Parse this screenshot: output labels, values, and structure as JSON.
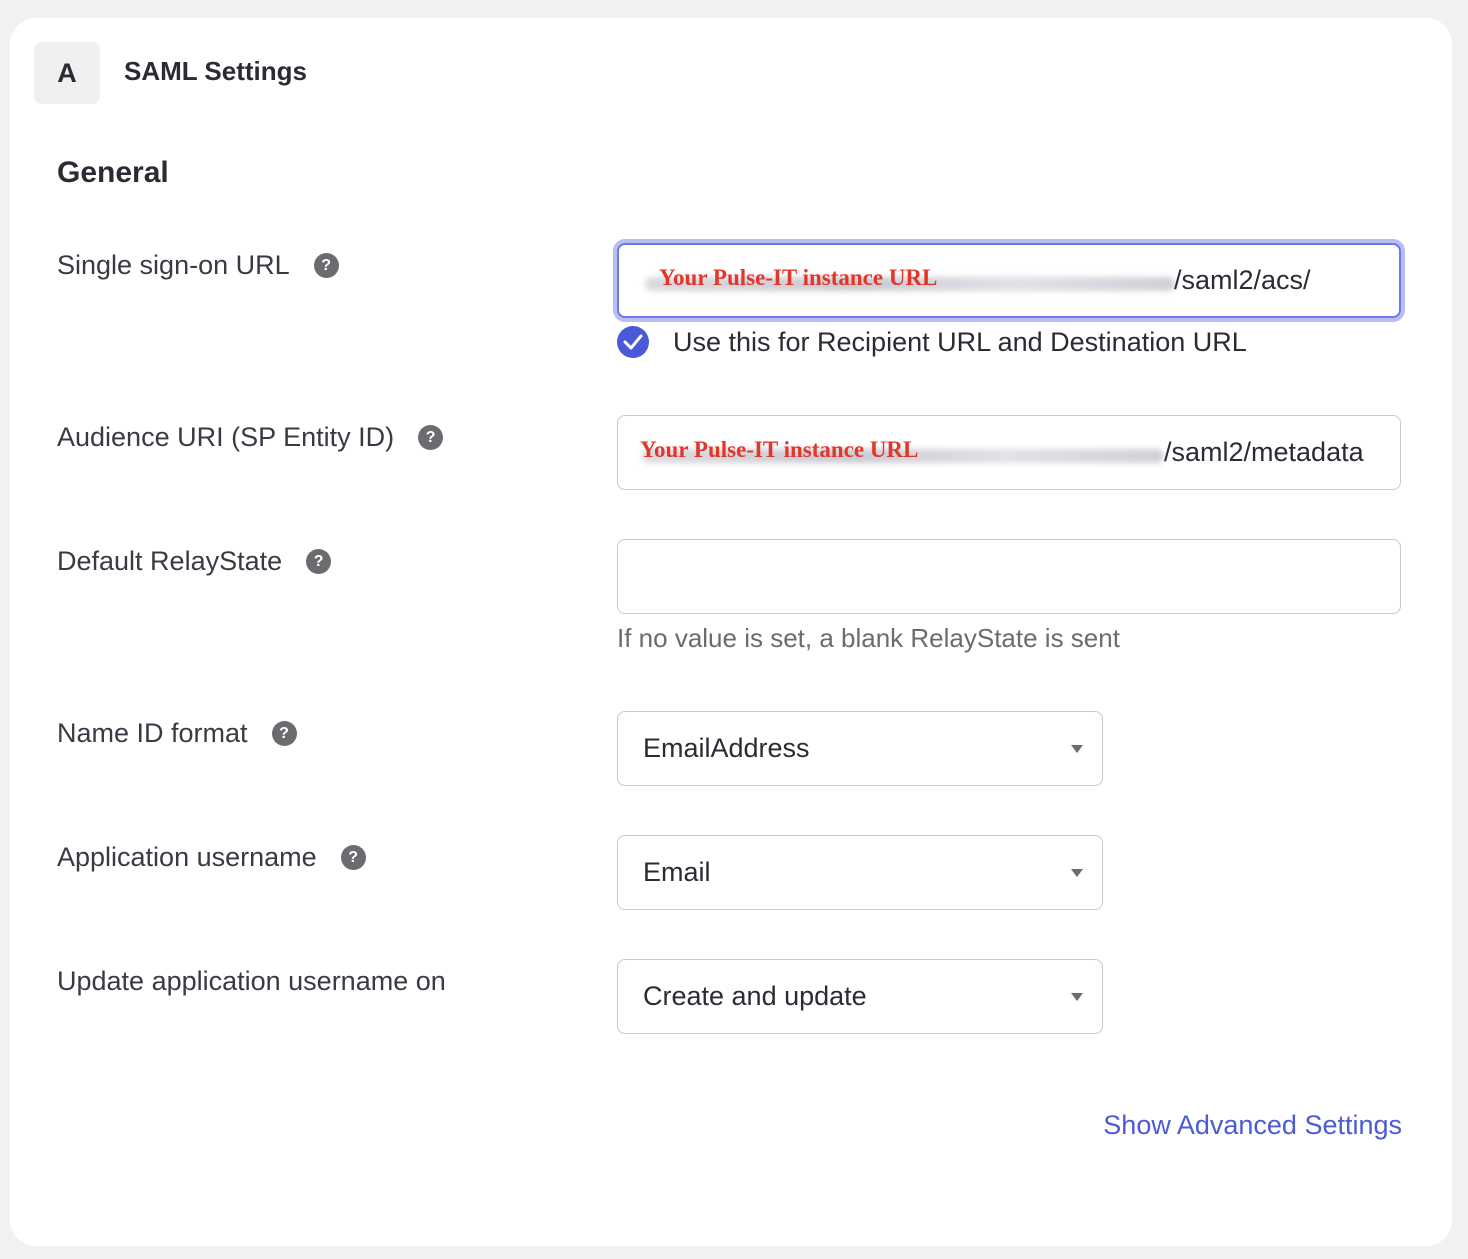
{
  "header": {
    "step": "A",
    "title": "SAML Settings"
  },
  "section": {
    "title": "General"
  },
  "help_icon_glyph": "?",
  "fields": {
    "sso_url": {
      "label": "Single sign-on URL",
      "value_suffix": "/saml2/acs/",
      "overlay_note": "Your Pulse-IT instance URL",
      "checkbox_label": "Use this for Recipient URL and Destination URL",
      "checkbox_checked": true
    },
    "audience_uri": {
      "label": "Audience URI (SP Entity ID)",
      "value_suffix": "/saml2/metadata",
      "overlay_note": "Your Pulse-IT instance URL"
    },
    "relay_state": {
      "label": "Default RelayState",
      "value": "",
      "hint": "If no value is set, a blank RelayState is sent"
    },
    "name_id_format": {
      "label": "Name ID format",
      "selected": "EmailAddress"
    },
    "app_username": {
      "label": "Application username",
      "selected": "Email"
    },
    "update_username_on": {
      "label": "Update application username on",
      "selected": "Create and update"
    }
  },
  "links": {
    "show_advanced": "Show Advanced Settings"
  },
  "colors": {
    "accent": "#4c5bd4",
    "focus_ring": "#6f79e6",
    "overlay_note": "#e2362b"
  }
}
